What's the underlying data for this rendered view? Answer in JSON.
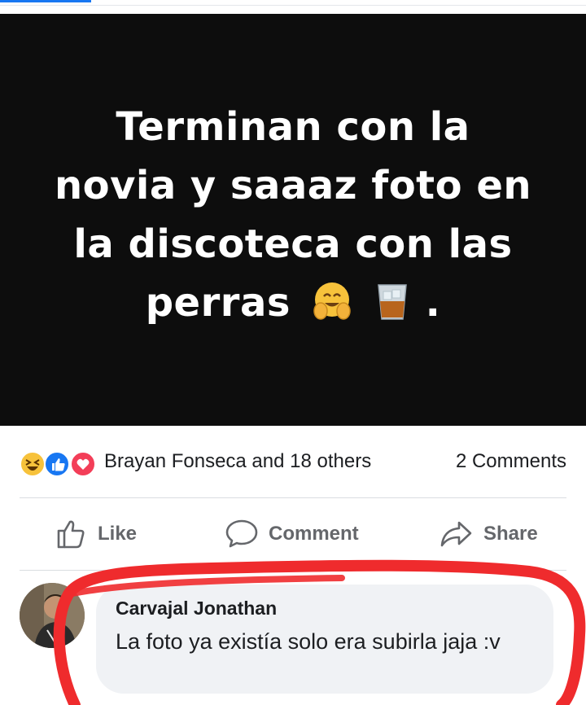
{
  "post": {
    "image_text_lines": [
      "Terminan con la",
      "novia y saaaz foto en",
      "la discoteca con las",
      "perras"
    ],
    "image_text_end": ".",
    "emojis": [
      "hugging-face-icon",
      "whisky-glass-icon"
    ],
    "background": "#0d0d0d"
  },
  "reactions": {
    "icons": [
      "haha-icon",
      "like-icon",
      "love-icon"
    ],
    "summary": "Brayan Fonseca and 18 others",
    "comments_count": "2 Comments"
  },
  "actions": {
    "like_label": "Like",
    "comment_label": "Comment",
    "share_label": "Share"
  },
  "comment": {
    "author": "Carvajal Jonathan",
    "text": "La foto ya existía solo era subirla jaja :v"
  },
  "colors": {
    "accent": "#1877f2",
    "action_gray": "#65676b",
    "bubble_bg": "#f0f2f5",
    "highlight_red": "#ef2b2d"
  }
}
